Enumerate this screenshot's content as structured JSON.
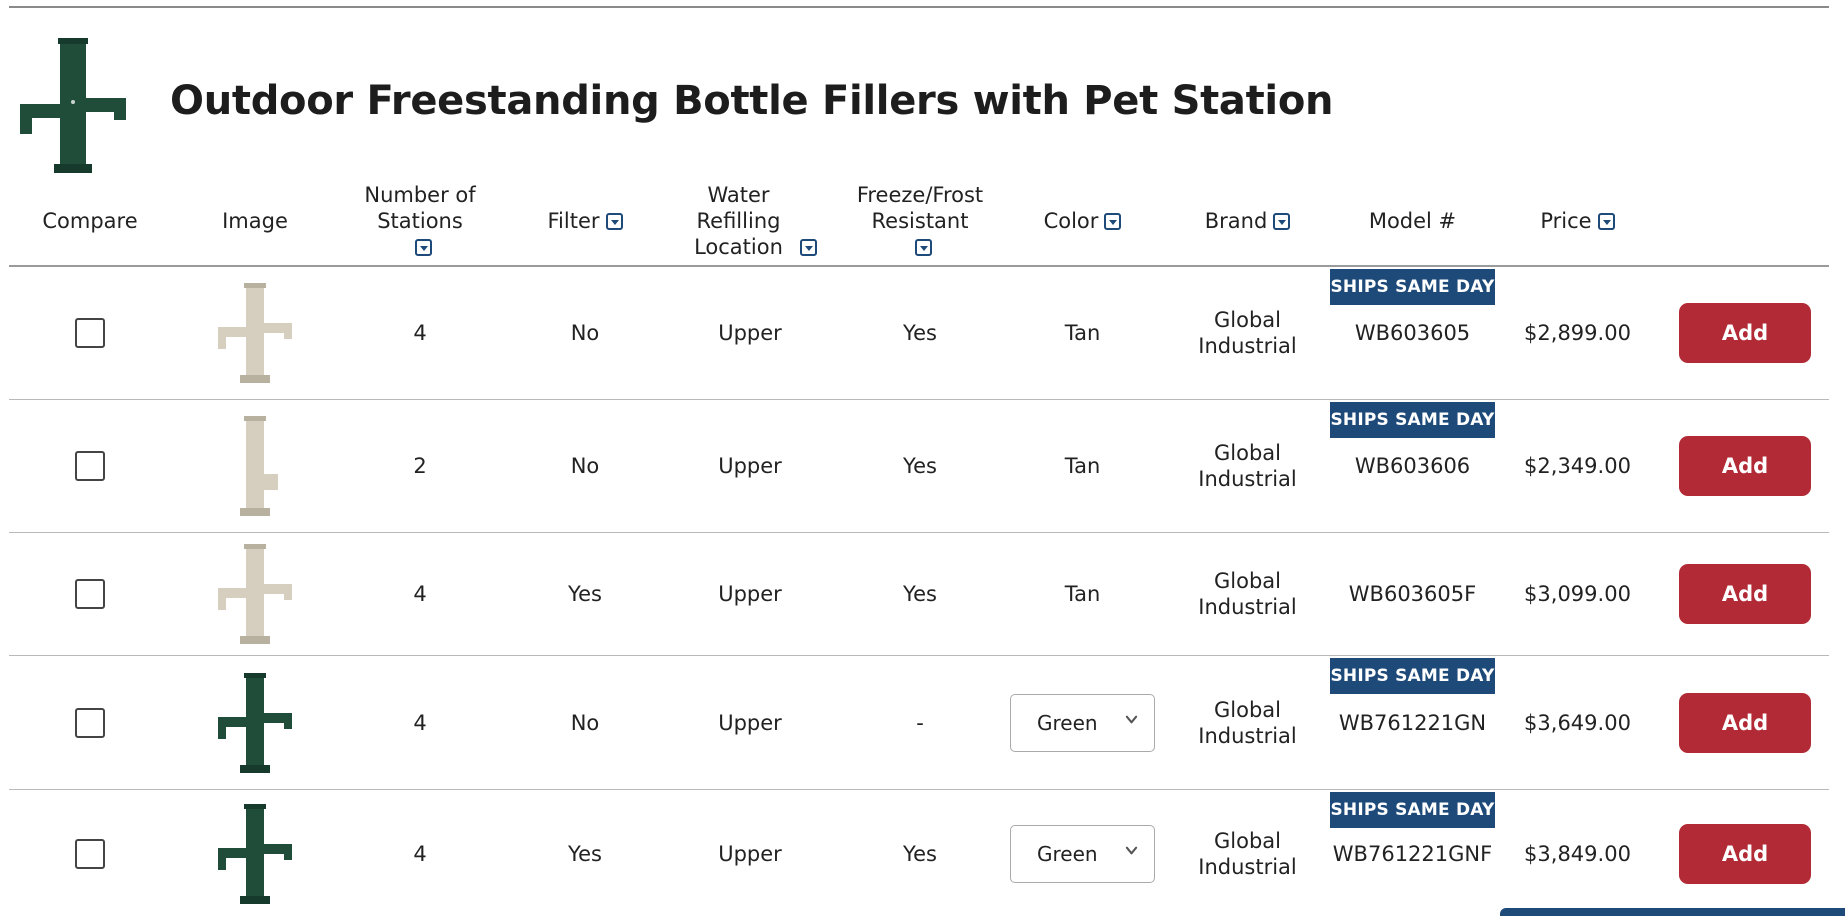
{
  "page": {
    "title": "Outdoor Freestanding Bottle Fillers with Pet Station"
  },
  "colors": {
    "navy": "#1e4a7a",
    "add_red": "#b22a35",
    "fountain_green": "#1f4d3a",
    "fountain_tan": "#d6cfbf"
  },
  "headers": {
    "compare": "Compare",
    "image": "Image",
    "stations": "Number of Stations",
    "filter": "Filter",
    "location": "Water Refilling Location",
    "freeze": "Freeze/Frost Resistant",
    "color": "Color",
    "brand": "Brand",
    "model": "Model #",
    "price": "Price"
  },
  "products": [
    {
      "image": "tan-fountain-4",
      "stations": "4",
      "filter": "No",
      "location": "Upper",
      "freeze": "Yes",
      "color": "Tan",
      "color_dropdown": false,
      "brand_line1": "Global",
      "brand_line2": "Industrial",
      "badge": "SHIPS SAME DAY",
      "model": "WB603605",
      "price": "$2,899.00",
      "add_label": "Add"
    },
    {
      "image": "tan-fountain-2",
      "stations": "2",
      "filter": "No",
      "location": "Upper",
      "freeze": "Yes",
      "color": "Tan",
      "color_dropdown": false,
      "brand_line1": "Global",
      "brand_line2": "Industrial",
      "badge": "SHIPS SAME DAY",
      "model": "WB603606",
      "price": "$2,349.00",
      "add_label": "Add"
    },
    {
      "image": "tan-fountain-4",
      "stations": "4",
      "filter": "Yes",
      "location": "Upper",
      "freeze": "Yes",
      "color": "Tan",
      "color_dropdown": false,
      "brand_line1": "Global",
      "brand_line2": "Industrial",
      "badge": "",
      "model": "WB603605F",
      "price": "$3,099.00",
      "add_label": "Add"
    },
    {
      "image": "green-fountain-4",
      "stations": "4",
      "filter": "No",
      "location": "Upper",
      "freeze": "-",
      "color": "Green",
      "color_dropdown": true,
      "brand_line1": "Global",
      "brand_line2": "Industrial",
      "badge": "SHIPS SAME DAY",
      "model": "WB761221GN",
      "price": "$3,649.00",
      "add_label": "Add"
    },
    {
      "image": "green-fountain-4",
      "stations": "4",
      "filter": "Yes",
      "location": "Upper",
      "freeze": "Yes",
      "color": "Green",
      "color_dropdown": true,
      "brand_line1": "Global",
      "brand_line2": "Industrial",
      "badge": "SHIPS SAME DAY",
      "model": "WB761221GNF",
      "price": "$3,849.00",
      "add_label": "Add"
    }
  ]
}
